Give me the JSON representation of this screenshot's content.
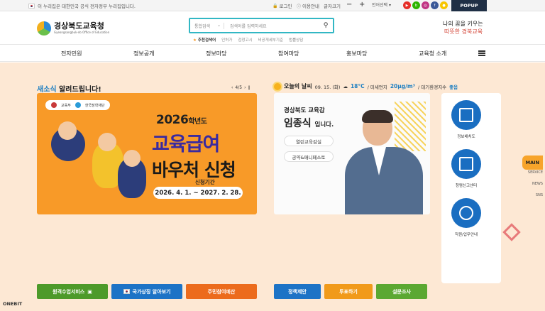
{
  "topbar": {
    "gov_notice": "이 누리집은 대한민국 공식 전자정부 누리집입니다.",
    "login": "로그인",
    "guide": "이용안내",
    "font_size": "글자크기",
    "zoom_out": "−",
    "zoom_in": "+",
    "language": "언어선택",
    "popup": "POPUP",
    "sns": [
      {
        "icon": "youtube-icon",
        "color": "#e52d27"
      },
      {
        "icon": "blog-icon",
        "color": "#2db400"
      },
      {
        "icon": "instagram-icon",
        "color": "#c13584"
      },
      {
        "icon": "facebook-icon",
        "color": "#3b5998"
      },
      {
        "icon": "kakao-icon",
        "color": "#f7c600"
      }
    ]
  },
  "header": {
    "logo_title": "경상북도교육청",
    "logo_sub": "Gyeongsangbuk-do Office of Education",
    "search_scope": "통합검색",
    "search_placeholder": "검색어를 입력하세요",
    "recommend_label": "추천검색어",
    "recommend": [
      "인허가",
      "검정고시",
      "비공개세부기준",
      "법률상담"
    ],
    "slogan_1": "나의 꿈을 키우는",
    "slogan_2": "따뜻한 경북교육"
  },
  "nav": [
    "전자민원",
    "정보공개",
    "정보마당",
    "참여마당",
    "홍보마당",
    "교육청 소개"
  ],
  "news": {
    "title_a": "새소식",
    "title_b": " 알려드립니다!",
    "pager": "4/5"
  },
  "banner": {
    "logo_a": "교육부",
    "logo_b": "한국장학재단",
    "year": "2026",
    "year_suffix": "학년도",
    "line1": "교육급여",
    "line2": "바우처 신청",
    "period_label": "신청기간",
    "period": "2026. 4. 1. ~ 2027. 2. 28."
  },
  "weather": {
    "label": "오늘의 날씨",
    "date": "09. 15. (화)",
    "temp": "18°C",
    "dust_label": "미세먼지",
    "dust": "20μg/m³",
    "air_label": "대기환경지수",
    "air": "좋음"
  },
  "superintendent": {
    "title": "경상북도 교육감",
    "name": "임종식",
    "name_suffix": "입니다.",
    "btn1": "열린교육감실",
    "btn2": "공약&매니페스토"
  },
  "side_services": [
    "정보배치도",
    "청렴신고센터",
    "직원/업무안내"
  ],
  "bottom_buttons": [
    {
      "label": "원격수업서비스",
      "color": "#4d9a2a"
    },
    {
      "label": "국가상징 알아보기",
      "color": "#1d73c6"
    },
    {
      "label": "주민참여예산",
      "color": "#ec6b1c"
    },
    {
      "label": "정책제안",
      "color": "#1d73c6"
    },
    {
      "label": "투표하기",
      "color": "#f19a1a"
    },
    {
      "label": "설문조사",
      "color": "#5ba832"
    }
  ],
  "right_nav": [
    "MAIN",
    "SERVICE",
    "NEWS",
    "SNS"
  ],
  "footer_brand": "ONEBIT"
}
